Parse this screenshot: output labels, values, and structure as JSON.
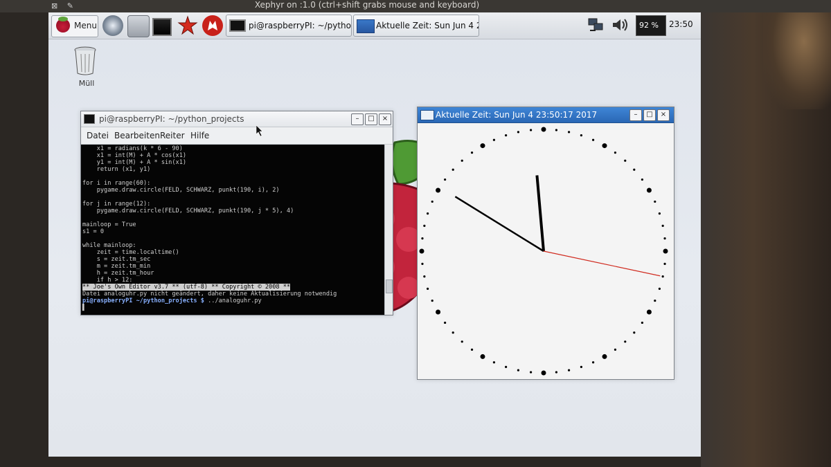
{
  "outer_window": {
    "title": "Xephyr on :1.0 (ctrl+shift grabs mouse and keyboard)",
    "icons": [
      "close-icon",
      "pin-icon"
    ]
  },
  "taskbar": {
    "menu_label": "Menu",
    "launchers": [
      "web-browser-icon",
      "file-manager-icon",
      "terminal-icon",
      "mathematica-icon",
      "wolfram-icon"
    ],
    "tasks": [
      {
        "label": "pi@raspberryPI: ~/python_...",
        "icon": "terminal-icon"
      },
      {
        "label": "Aktuelle Zeit: Sun Jun  4 23...",
        "icon": "window-icon"
      }
    ],
    "tray": {
      "cpu": "92 %",
      "time": "23:50"
    }
  },
  "desktop": {
    "trash_label": "Müll"
  },
  "terminal_window": {
    "title": "pi@raspberryPI: ~/python_projects",
    "menu": [
      "Datei",
      "Bearbeiten",
      "Reiter",
      "Hilfe"
    ],
    "lines": [
      "    x1 = radians(k * 6 - 90)",
      "    x1 = int(M) + A * cos(x1)",
      "    y1 = int(M) + A * sin(x1)",
      "    return (x1, y1)",
      "",
      "for i in range(60):",
      "    pygame.draw.circle(FELD, SCHWARZ, punkt(190, i), 2)",
      "",
      "for j in range(12):",
      "    pygame.draw.circle(FELD, SCHWARZ, punkt(190, j * 5), 4)",
      "",
      "mainloop = True",
      "s1 = 0",
      "",
      "while mainloop:",
      "    zeit = time.localtime()",
      "    s = zeit.tm_sec",
      "    m = zeit.tm_min",
      "    h = zeit.tm_hour",
      "    if h > 12:"
    ],
    "status_line": "** Joe's Own Editor v3.7 ** (utf-8) ** Copyright © 2008 **",
    "message_line": "Datei analoguhr.py nicht geändert, daher keine Aktualisierung notwendig",
    "prompt_user": "pi@raspberryPI",
    "prompt_path": "~/python_projects $",
    "prompt_cmd": " ../analoguhr.py"
  },
  "clock_window": {
    "title": "Aktuelle Zeit: Sun Jun  4 23:50:17 2017",
    "time": {
      "hour": 23,
      "minute": 50,
      "second": 17
    },
    "colors": {
      "hands": "#000000",
      "second_hand": "#d02a1e",
      "dots": "#000000",
      "face": "#f4f4f4"
    }
  },
  "window_buttons": {
    "minimize": "–",
    "maximize": "□",
    "close": "×"
  },
  "colors": {
    "titlebar_active": "#2f6fbf",
    "terminal_bg": "#050505"
  }
}
